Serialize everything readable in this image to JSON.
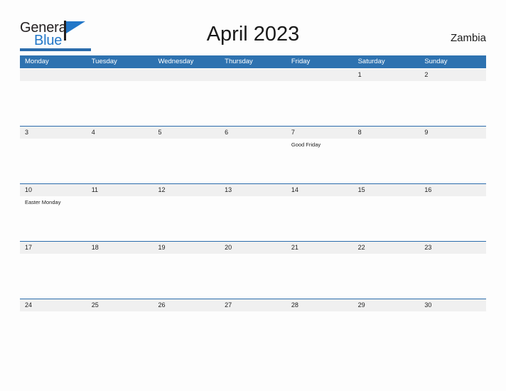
{
  "brand": {
    "name_top": "General",
    "name_bottom": "Blue",
    "accent_color": "#2277c8",
    "bar_color": "#2b6cac"
  },
  "header": {
    "title": "April 2023",
    "country": "Zambia"
  },
  "calendar": {
    "header_color": "#2e72b0",
    "band_color": "#f0f0f0",
    "rule_color": "#2b6cac",
    "weekdays": [
      "Monday",
      "Tuesday",
      "Wednesday",
      "Thursday",
      "Friday",
      "Saturday",
      "Sunday"
    ],
    "weeks": [
      [
        {
          "day": "",
          "event": ""
        },
        {
          "day": "",
          "event": ""
        },
        {
          "day": "",
          "event": ""
        },
        {
          "day": "",
          "event": ""
        },
        {
          "day": "",
          "event": ""
        },
        {
          "day": "1",
          "event": ""
        },
        {
          "day": "2",
          "event": ""
        }
      ],
      [
        {
          "day": "3",
          "event": ""
        },
        {
          "day": "4",
          "event": ""
        },
        {
          "day": "5",
          "event": ""
        },
        {
          "day": "6",
          "event": ""
        },
        {
          "day": "7",
          "event": "Good Friday"
        },
        {
          "day": "8",
          "event": ""
        },
        {
          "day": "9",
          "event": ""
        }
      ],
      [
        {
          "day": "10",
          "event": "Easter Monday"
        },
        {
          "day": "11",
          "event": ""
        },
        {
          "day": "12",
          "event": ""
        },
        {
          "day": "13",
          "event": ""
        },
        {
          "day": "14",
          "event": ""
        },
        {
          "day": "15",
          "event": ""
        },
        {
          "day": "16",
          "event": ""
        }
      ],
      [
        {
          "day": "17",
          "event": ""
        },
        {
          "day": "18",
          "event": ""
        },
        {
          "day": "19",
          "event": ""
        },
        {
          "day": "20",
          "event": ""
        },
        {
          "day": "21",
          "event": ""
        },
        {
          "day": "22",
          "event": ""
        },
        {
          "day": "23",
          "event": ""
        }
      ],
      [
        {
          "day": "24",
          "event": ""
        },
        {
          "day": "25",
          "event": ""
        },
        {
          "day": "26",
          "event": ""
        },
        {
          "day": "27",
          "event": ""
        },
        {
          "day": "28",
          "event": ""
        },
        {
          "day": "29",
          "event": ""
        },
        {
          "day": "30",
          "event": ""
        }
      ]
    ]
  }
}
